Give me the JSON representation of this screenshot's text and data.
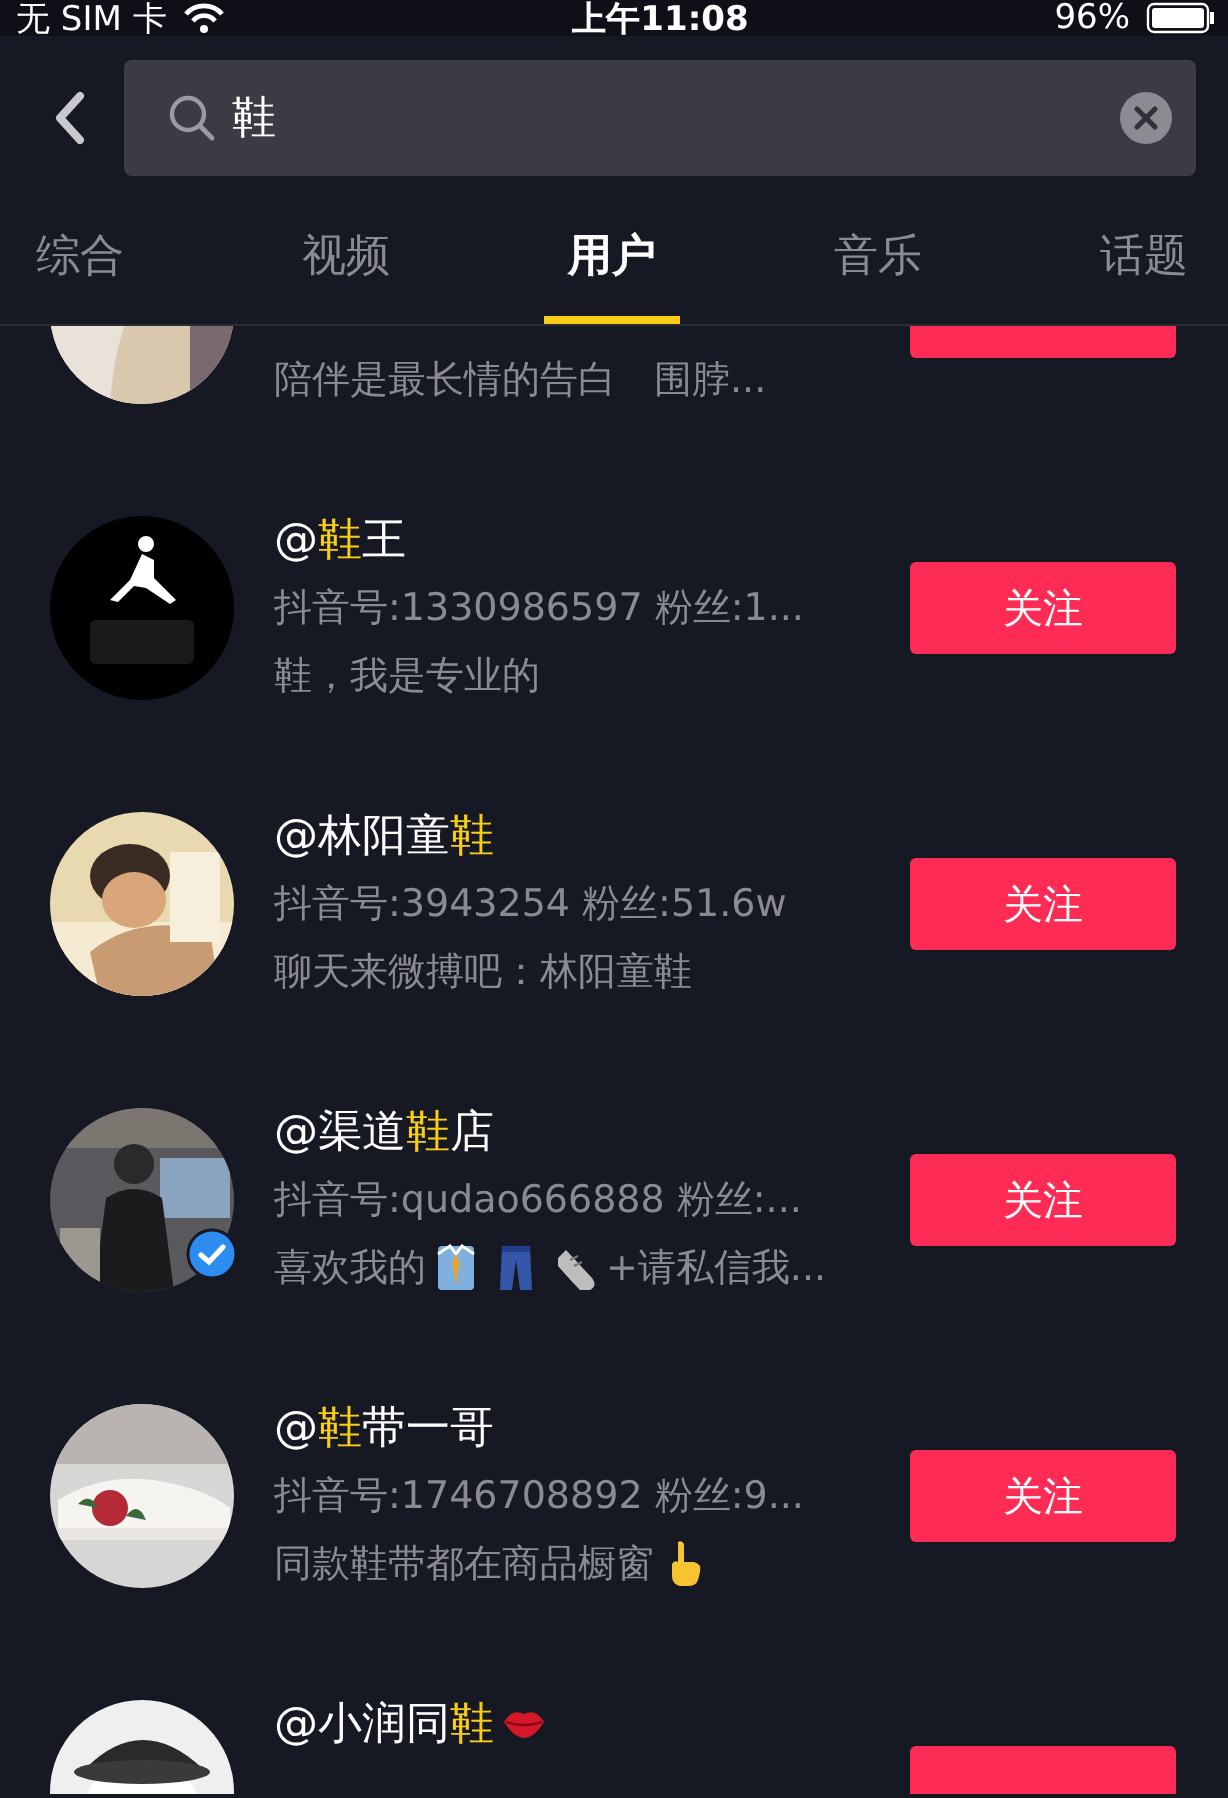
{
  "status_bar": {
    "carrier": "无 SIM 卡",
    "time": "上午11:08",
    "battery": "96%"
  },
  "search": {
    "value": "鞋"
  },
  "tabs": [
    {
      "label": "综合",
      "selected": false
    },
    {
      "label": "视频",
      "selected": false
    },
    {
      "label": "用户",
      "selected": true
    },
    {
      "label": "音乐",
      "selected": false
    },
    {
      "label": "话题",
      "selected": false
    }
  ],
  "users": [
    {
      "verified": false,
      "desc": [
        {
          "kind": "text",
          "text": "陪伴是最长情的告白　围脖..."
        }
      ]
    },
    {
      "verified": false,
      "name": [
        {
          "text": "@",
          "highlight": false
        },
        {
          "text": "鞋",
          "highlight": true
        },
        {
          "text": "王",
          "highlight": false
        }
      ],
      "id_line": "抖音号:1330986597  粉丝:1...",
      "desc": [
        {
          "kind": "text",
          "text": "鞋，我是专业的"
        }
      ],
      "button": "关注"
    },
    {
      "verified": false,
      "name": [
        {
          "text": "@林阳童",
          "highlight": false
        },
        {
          "text": "鞋",
          "highlight": true
        }
      ],
      "id_line": "抖音号:3943254  粉丝:51.6w",
      "desc": [
        {
          "kind": "text",
          "text": "聊天来微搏吧：林阳童鞋"
        }
      ],
      "button": "关注"
    },
    {
      "verified": true,
      "name": [
        {
          "text": "@渠道",
          "highlight": false
        },
        {
          "text": "鞋",
          "highlight": true
        },
        {
          "text": "店",
          "highlight": false
        }
      ],
      "id_line": "抖音号:qudao666888  粉丝:...",
      "desc": [
        {
          "kind": "text",
          "text": "喜欢我的"
        },
        {
          "kind": "shirt"
        },
        {
          "kind": "jeans"
        },
        {
          "kind": "shoe"
        },
        {
          "kind": "text",
          "text": "+请私信我..."
        }
      ],
      "button": "关注"
    },
    {
      "verified": false,
      "name": [
        {
          "text": "@",
          "highlight": false
        },
        {
          "text": "鞋",
          "highlight": true
        },
        {
          "text": "带一哥",
          "highlight": false
        }
      ],
      "id_line": "抖音号:1746708892  粉丝:9...",
      "desc": [
        {
          "kind": "text",
          "text": "同款鞋带都在商品橱窗"
        },
        {
          "kind": "pointing-hand"
        }
      ],
      "button": "关注"
    },
    {
      "verified": false,
      "name": [
        {
          "text": "@小润同",
          "highlight": false
        },
        {
          "text": "鞋",
          "highlight": true
        },
        {
          "kind": "lips"
        }
      ]
    }
  ]
}
